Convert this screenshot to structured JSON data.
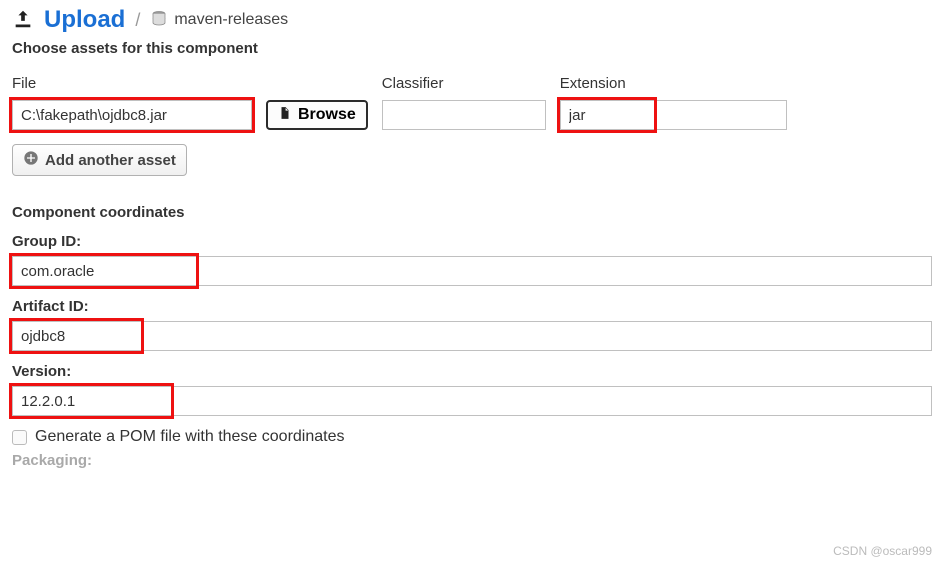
{
  "header": {
    "title": "Upload",
    "repository": "maven-releases"
  },
  "assets": {
    "heading": "Choose assets for this component",
    "file_label": "File",
    "classifier_label": "Classifier",
    "extension_label": "Extension",
    "file_value": "C:\\fakepath\\ojdbc8.jar",
    "classifier_value": "",
    "extension_value": "jar",
    "browse_label": "Browse",
    "add_asset_label": "Add another asset"
  },
  "coordinates": {
    "heading": "Component coordinates",
    "group_label": "Group ID:",
    "group_value": "com.oracle",
    "artifact_label": "Artifact ID:",
    "artifact_value": "ojdbc8",
    "version_label": "Version:",
    "version_value": "12.2.0.1",
    "generate_pom_label": "Generate a POM file with these coordinates",
    "packaging_label": "Packaging:"
  },
  "footer": {
    "watermark": "CSDN @oscar999"
  },
  "highlight_overlays": {
    "group_width": 190,
    "artifact_width": 135,
    "version_width": 165,
    "extension_width": 100
  }
}
